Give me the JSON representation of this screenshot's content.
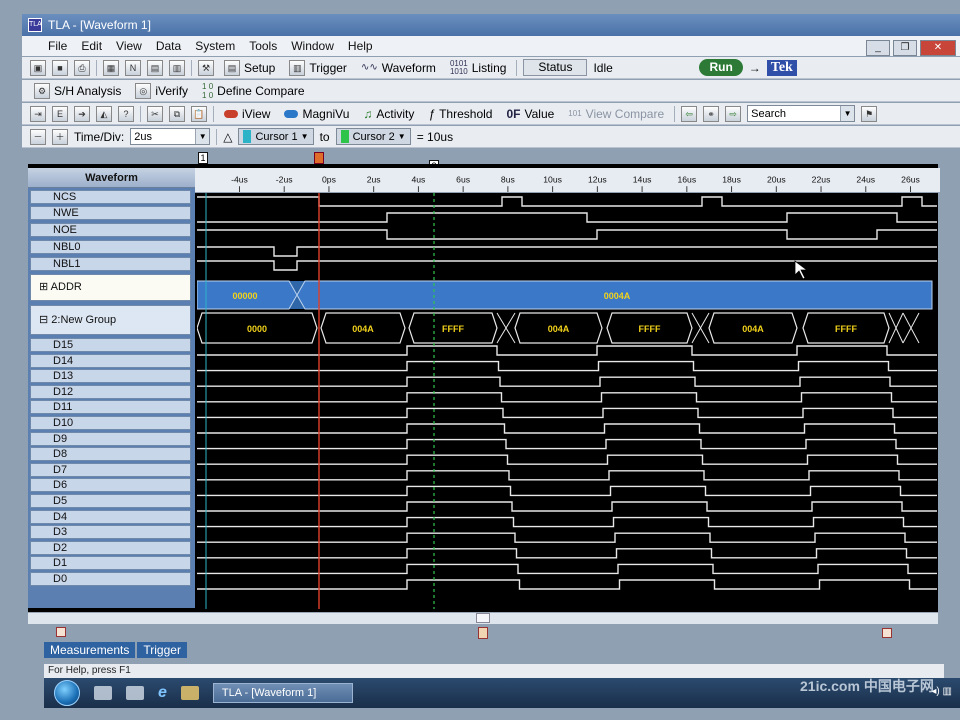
{
  "window": {
    "title": "TLA - [Waveform 1]",
    "app_icon": "tla-app-icon"
  },
  "menu": [
    "File",
    "Edit",
    "View",
    "Data",
    "System",
    "Tools",
    "Window",
    "Help"
  ],
  "toolbar1": {
    "setup": "Setup",
    "trigger": "Trigger",
    "waveform": "Waveform",
    "listing": "Listing",
    "status_btn": "Status",
    "status_text": "Idle",
    "run": "Run",
    "brand": "Tek"
  },
  "toolbar2": {
    "sh": "S/H Analysis",
    "iverify": "iVerify",
    "define_compare": "Define Compare"
  },
  "toolbar3": {
    "iview": "iView",
    "magnivu": "MagniVu",
    "activity": "Activity",
    "threshold": "Threshold",
    "value": "Value",
    "view_compare": "View Compare",
    "search": "Search"
  },
  "toolbar4": {
    "timediv_label": "Time/Div:",
    "timediv_value": "2us",
    "cursor1": "Cursor 1",
    "to": "to",
    "cursor2": "Cursor 2",
    "delta": "= 10us"
  },
  "waveform_header": "Waveform",
  "ruler_ticks": [
    "-4us",
    "-2us",
    "0ps",
    "2us",
    "4us",
    "6us",
    "8us",
    "10us",
    "12us",
    "14us",
    "16us",
    "18us",
    "20us",
    "22us",
    "24us",
    "26us"
  ],
  "cursor_marks": [
    "1",
    "2"
  ],
  "signals_top": [
    "NCS",
    "NWE",
    "NOE",
    "NBL0",
    "NBL1"
  ],
  "bus_addr": {
    "name": "ADDR",
    "values": [
      "00000",
      "0004A"
    ]
  },
  "bus_group": {
    "name": "2:New Group",
    "values": [
      "0000",
      "004A",
      "FFFF",
      "004A",
      "FFFF",
      "004A",
      "FFFF"
    ]
  },
  "data_bits": [
    "D15",
    "D14",
    "D13",
    "D12",
    "D11",
    "D10",
    "D9",
    "D8",
    "D7",
    "D6",
    "D5",
    "D4",
    "D3",
    "D2",
    "D1",
    "D0"
  ],
  "colors": {
    "trace": "#e8e8e8",
    "bus_fill": "#3b78c8",
    "bus_text": "#f2d21b",
    "cursor1": "#e0402c",
    "cursor2": "#2ec44a"
  },
  "tabs": [
    "Measurements",
    "Trigger"
  ],
  "help_text": "For Help, press F1",
  "taskbar_item": "TLA - [Waveform 1]",
  "watermark": "21ic.com 中国电子网"
}
